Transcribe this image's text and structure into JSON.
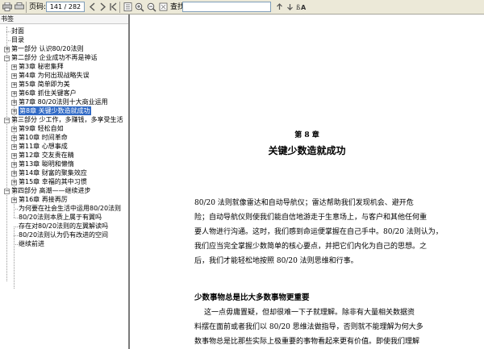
{
  "toolbar": {
    "page_label": "页码:",
    "page_value": "141 / 282",
    "search_label": "查找:"
  },
  "sidebar": {
    "header": "书签",
    "items": [
      {
        "label": "封面"
      },
      {
        "label": "目录"
      },
      {
        "label": "第一部分 认识80/20法则"
      },
      {
        "label": "第二部分 企业成功不再是神话"
      },
      {
        "label": "第3章 秘密集拜"
      },
      {
        "label": "第4章 为何出现战略失误"
      },
      {
        "label": "第5章 简单即为美"
      },
      {
        "label": "第6章 抓住关键客户"
      },
      {
        "label": "第7章 80/20法则十大商业运用"
      },
      {
        "label": "第8章 关键少数造就成功"
      },
      {
        "label": "第三部分 少工作，多赚钱，多享受生活"
      },
      {
        "label": "第9章 轻松自如"
      },
      {
        "label": "第10章 时间革命"
      },
      {
        "label": "第11章 心想事成"
      },
      {
        "label": "第12章 交友贵在精"
      },
      {
        "label": "第13章 聪明和懒惰"
      },
      {
        "label": "第14章 财富的聚集效应"
      },
      {
        "label": "第15章 幸福的其中习惯"
      },
      {
        "label": "第四部分 高潮——继续进步"
      },
      {
        "label": "第16章 再接再厉"
      },
      {
        "label": "为何要在社会生活中运用80/20法则"
      },
      {
        "label": "80/20法则本质上属于有翼吗"
      },
      {
        "label": "存在对80/20法则的左翼解读吗"
      },
      {
        "label": "80/20法则认为仍有改进的空间"
      },
      {
        "label": "继续前进"
      }
    ]
  },
  "content": {
    "chapter_number": "第 8 章",
    "chapter_title": "关键少数造就成功",
    "paragraph1": [
      "80/20 法则就像雷达和自动导航仪；雷达帮助我们发现机会、避开危",
      "险；自动导航仪则使我们能自信地游走于生意场上，与客户和其他任何重",
      "要人物进行沟通。这时，我们感到命运便掌握在自己手中。80/20 法则认为，",
      "我们应当完全掌握少数简单的核心要点，并把它们内化为自己的思想。之",
      "后，我们才能轻松地按照 80/20 法则思维和行事。"
    ],
    "section_title": "少数事物总是比大多数事物更重要",
    "paragraph2": [
      "这一点毋庸置疑，但却很难一下子就理解。除非有大量相关数据资",
      "料摆在面前或者我们以 80/20 思维法做指导，否则就不能理解为何大多",
      "数事物总是比那些实际上极重要的事物看起来更有价值。即使我们理解"
    ]
  }
}
